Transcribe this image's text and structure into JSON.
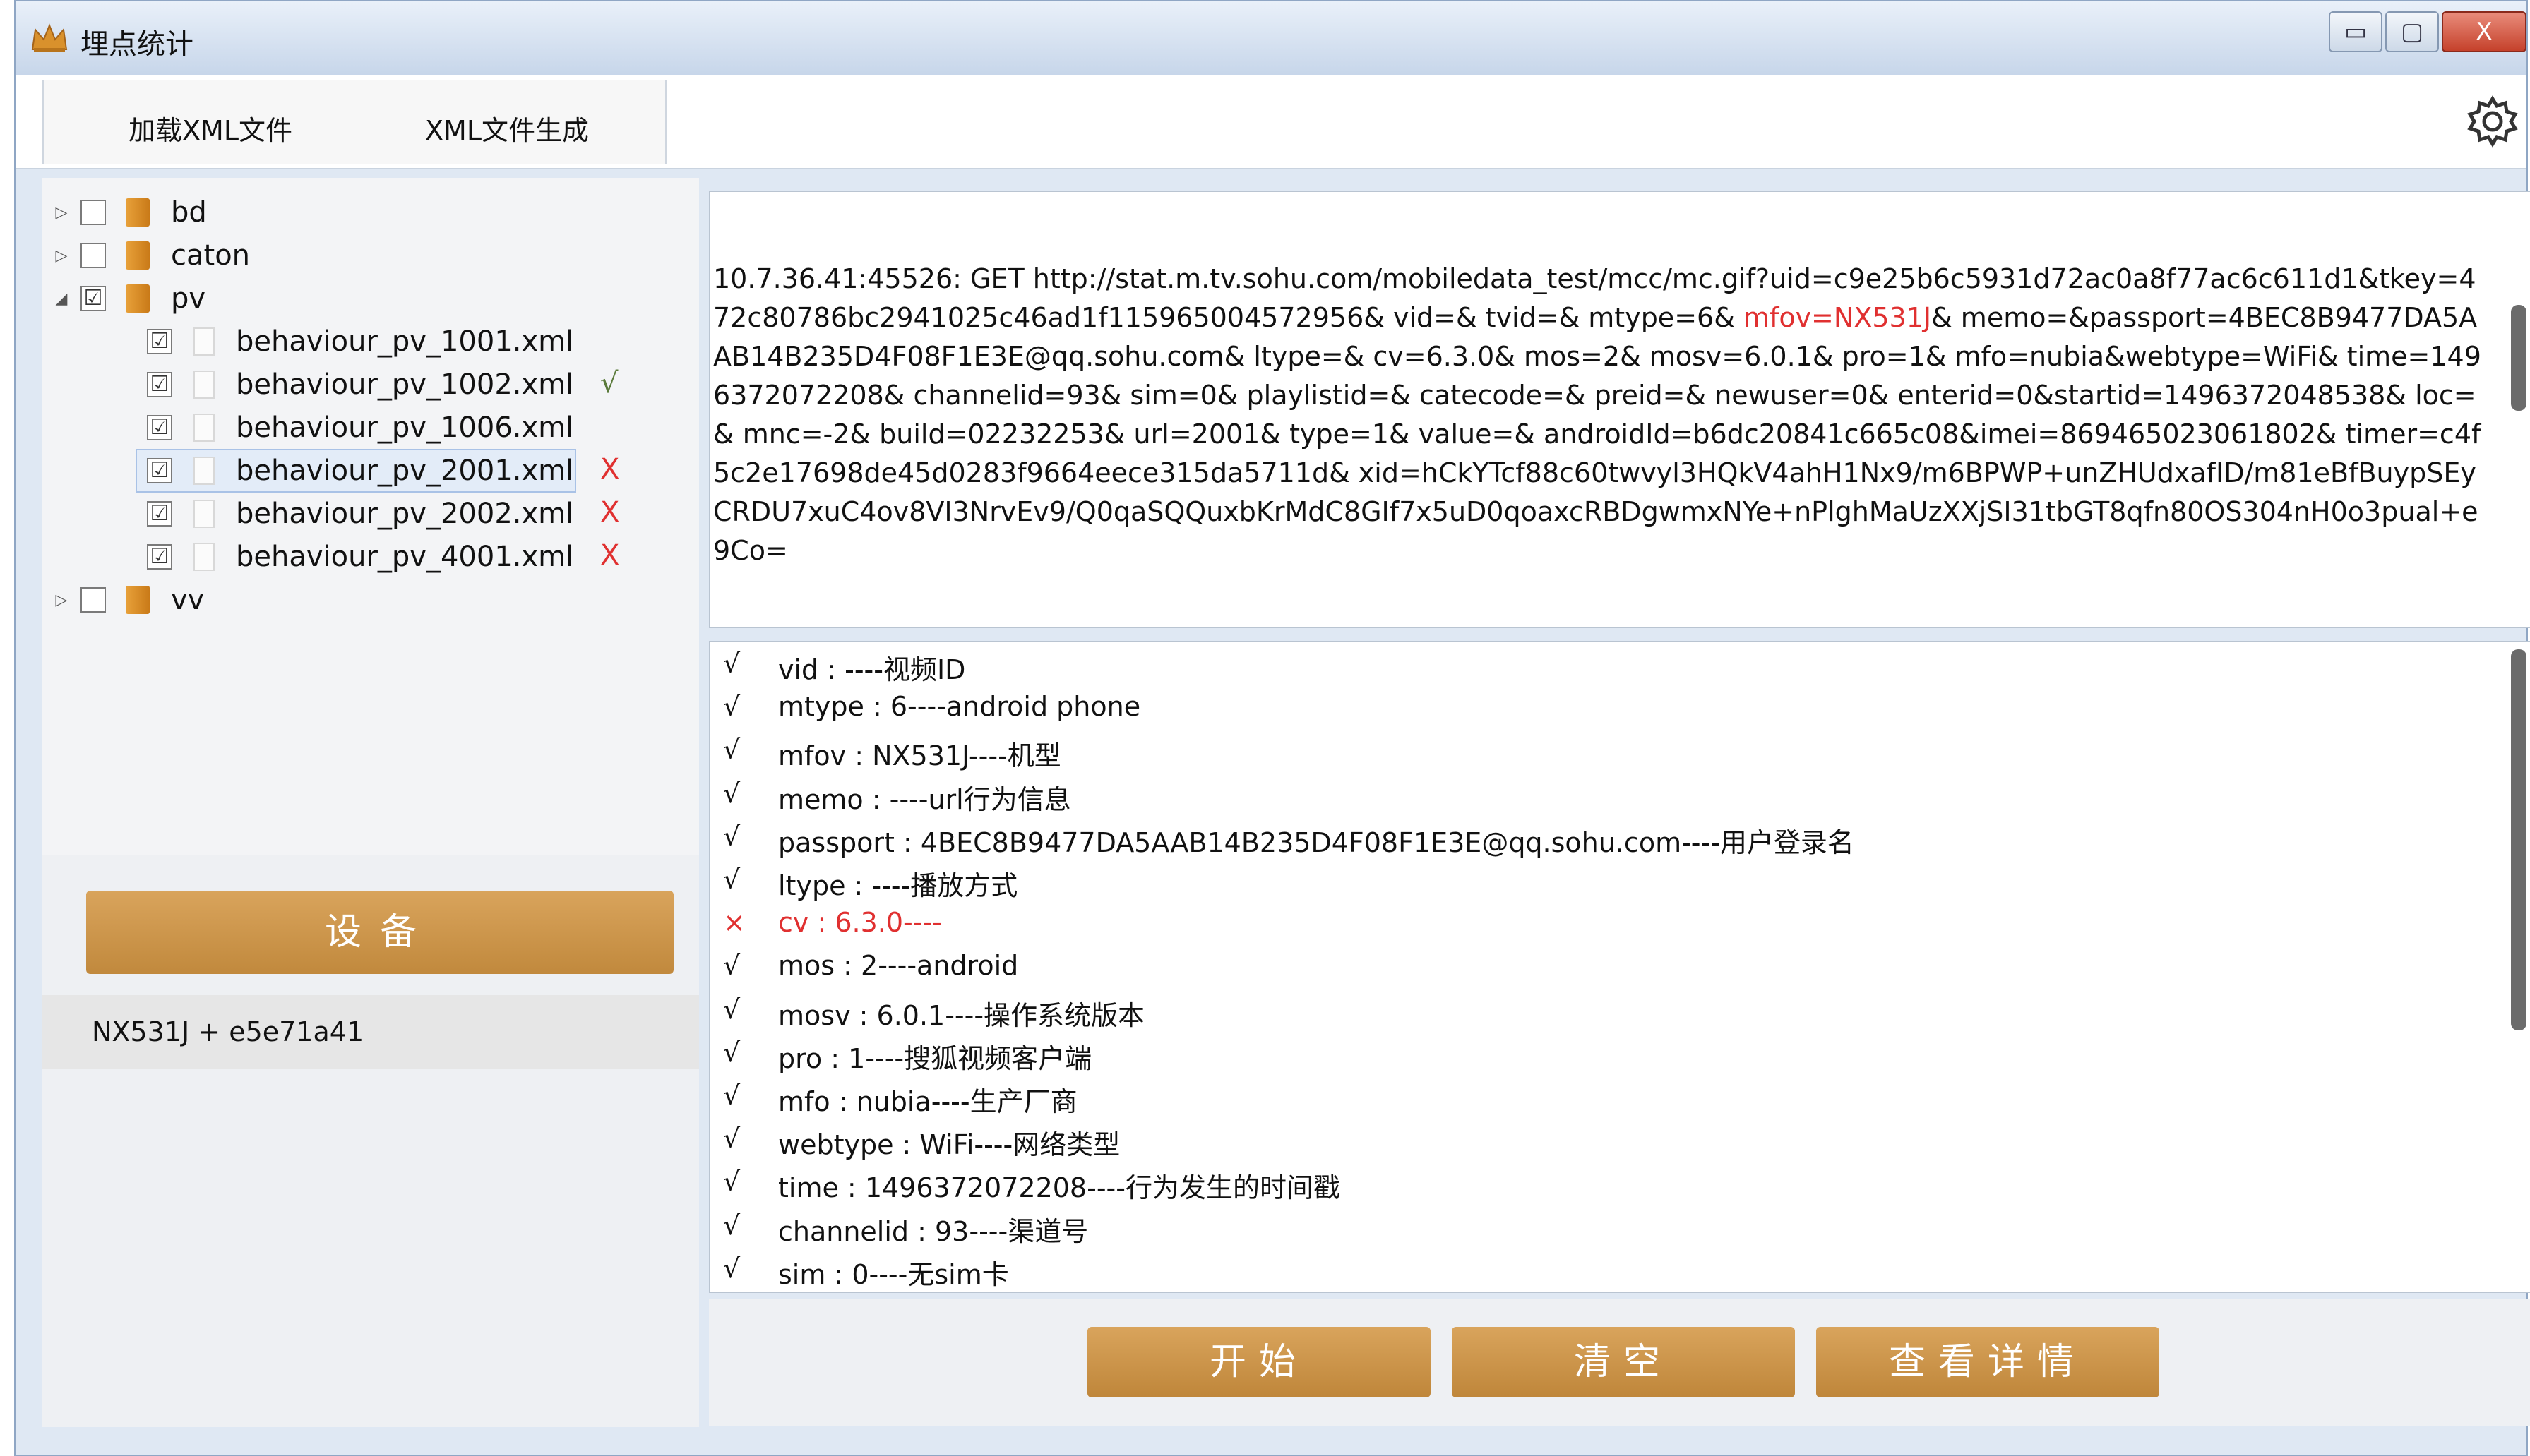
{
  "window": {
    "title": "埋点统计",
    "controls": {
      "minimize": "▭",
      "maximize": "▢",
      "close": "X"
    }
  },
  "toolbar": {
    "load_xml": "加载XML文件",
    "gen_xml": "XML文件生成"
  },
  "tree": {
    "nodes": [
      {
        "expander": "▷",
        "checked": "",
        "type": "folder",
        "label": "bd",
        "mark": ""
      },
      {
        "expander": "▷",
        "checked": "",
        "type": "folder",
        "label": "caton",
        "mark": ""
      },
      {
        "expander": "◢",
        "checked": "☑",
        "type": "folder",
        "label": "pv",
        "mark": ""
      },
      {
        "expander": "",
        "checked": "☑",
        "type": "file",
        "label": "behaviour_pv_1001.xml",
        "mark": "",
        "mark_color": "#d8b070"
      },
      {
        "expander": "",
        "checked": "☑",
        "type": "file",
        "label": "behaviour_pv_1002.xml",
        "mark": "√",
        "mark_color": "#5a7a3a"
      },
      {
        "expander": "",
        "checked": "☑",
        "type": "file",
        "label": "behaviour_pv_1006.xml",
        "mark": "",
        "mark_color": "#d8b070"
      },
      {
        "expander": "",
        "checked": "☑",
        "type": "file",
        "label": "behaviour_pv_2001.xml",
        "mark": "X",
        "mark_color": "#e03030",
        "selected": true
      },
      {
        "expander": "",
        "checked": "☑",
        "type": "file",
        "label": "behaviour_pv_2002.xml",
        "mark": "X",
        "mark_color": "#e03030"
      },
      {
        "expander": "",
        "checked": "☑",
        "type": "file",
        "label": "behaviour_pv_4001.xml",
        "mark": "X",
        "mark_color": "#e03030"
      },
      {
        "expander": "▷",
        "checked": "",
        "type": "folder",
        "label": "vv",
        "mark": ""
      }
    ]
  },
  "device": {
    "button_label": "设备",
    "info": "NX531J + e5e71a41"
  },
  "request": {
    "before": "10.7.36.41:45526: GET http://stat.m.tv.sohu.com/mobiledata_test/mcc/mc.gif?uid=c9e25b6c5931d72ac0a8f77ac6c611d1&tkey=472c80786bc2941025c46ad1f115965004572956& vid=& tvid=& mtype=6& ",
    "highlight": "mfov=NX531J",
    "after": "& memo=&passport=4BEC8B9477DA5AAB14B235D4F08F1E3E@qq.sohu.com& ltype=& cv=6.3.0& mos=2& mosv=6.0.1& pro=1& mfo=nubia&webtype=WiFi& time=1496372072208& channelid=93& sim=0& playlistid=& catecode=& preid=& newuser=0& enterid=0&startid=1496372048538& loc=& mnc=-2& build=02232253& url=2001& type=1& value=& androidId=b6dc20841c665c08&imei=869465023061802& timer=c4f5c2e17698de45d0283f9664eece315da5711d& xid=hCkYTcf88c60twvyl3HQkV4ahH1Nx9/m6BPWP+unZHUdxafID/m81eBfBuypSEyCRDU7xuC4ov8VI3NrvEv9/Q0qaSQQuxbKrMdC8GIf7x5uD0qoaxcRBDgwmxNYe+nPlghMaUzXXjSI31tbGT8qfn80OS304nH0o3pual+e9Co="
  },
  "params": [
    {
      "mark": "√",
      "text": "vid : ----视频ID",
      "error": false
    },
    {
      "mark": "√",
      "text": "mtype : 6----android phone",
      "error": false
    },
    {
      "mark": "√",
      "text": "mfov : NX531J----机型",
      "error": false
    },
    {
      "mark": "√",
      "text": "memo : ----url行为信息",
      "error": false
    },
    {
      "mark": "√",
      "text": "passport : 4BEC8B9477DA5AAB14B235D4F08F1E3E@qq.sohu.com----用户登录名",
      "error": false
    },
    {
      "mark": "√",
      "text": "ltype : ----播放方式",
      "error": false
    },
    {
      "mark": "×",
      "text": "cv : 6.3.0----",
      "error": true
    },
    {
      "mark": "√",
      "text": "mos : 2----android",
      "error": false
    },
    {
      "mark": "√",
      "text": "mosv : 6.0.1----操作系统版本",
      "error": false
    },
    {
      "mark": "√",
      "text": "pro : 1----搜狐视频客户端",
      "error": false
    },
    {
      "mark": "√",
      "text": "mfo : nubia----生产厂商",
      "error": false
    },
    {
      "mark": "√",
      "text": "webtype : WiFi----网络类型",
      "error": false
    },
    {
      "mark": "√",
      "text": "time : 1496372072208----行为发生的时间戳",
      "error": false
    },
    {
      "mark": "√",
      "text": "channelid : 93----渠道号",
      "error": false
    },
    {
      "mark": "√",
      "text": "sim : 0----无sim卡",
      "error": false
    }
  ],
  "actions": {
    "start": "开始",
    "clear": "清空",
    "details": "查看详情"
  },
  "icons": {
    "app": "crown-icon",
    "settings": "gear-icon",
    "folder": "folder-icon",
    "file": "file-icon"
  },
  "colors": {
    "accent_gold": "#c99548",
    "error_red": "#e03030",
    "titlebar": "#c7d6ea"
  }
}
